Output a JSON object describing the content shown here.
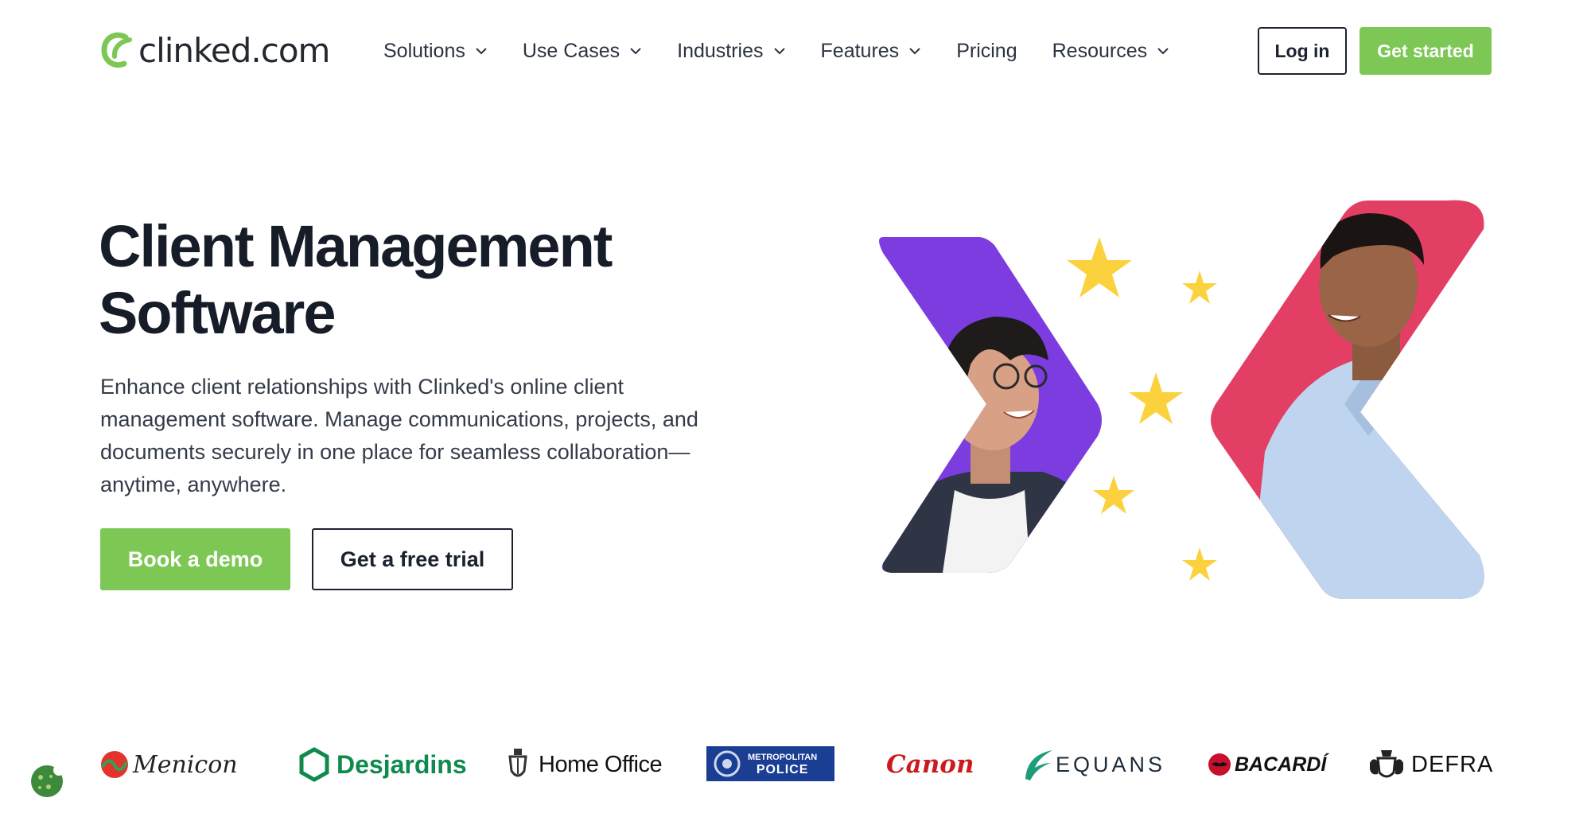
{
  "brand": {
    "logo_text": "clinked.com",
    "accent_color": "#7dc855"
  },
  "nav": {
    "items": [
      {
        "label": "Solutions",
        "has_dropdown": true,
        "icon": "chevron-down-icon"
      },
      {
        "label": "Use Cases",
        "has_dropdown": true,
        "icon": "chevron-down-icon"
      },
      {
        "label": "Industries",
        "has_dropdown": true,
        "icon": "chevron-down-icon"
      },
      {
        "label": "Features",
        "has_dropdown": true,
        "icon": "chevron-down-icon"
      },
      {
        "label": "Pricing",
        "has_dropdown": false
      },
      {
        "label": "Resources",
        "has_dropdown": true,
        "icon": "chevron-down-icon"
      }
    ],
    "login_label": "Log in",
    "get_started_label": "Get started"
  },
  "hero": {
    "title_line1": "Client Management",
    "title_line2": "Software",
    "description": "Enhance client relationships with Clinked's online client management software. Manage communications, projects, and documents securely in one place for seamless collaboration—anytime, anywhere.",
    "demo_label": "Book a demo",
    "trial_label": "Get a free trial",
    "art_colors": {
      "purple": "#7c3ce0",
      "red": "#e33f65",
      "star": "#fbd23d"
    }
  },
  "client_logos": [
    "Menicon",
    "Desjardins",
    "Home Office",
    "METROPOLITAN",
    "POLICE",
    "Canon",
    "EQUANS",
    "BACARDÍ",
    "DEFRA"
  ],
  "cookie": {
    "icon": "cookie-icon"
  }
}
